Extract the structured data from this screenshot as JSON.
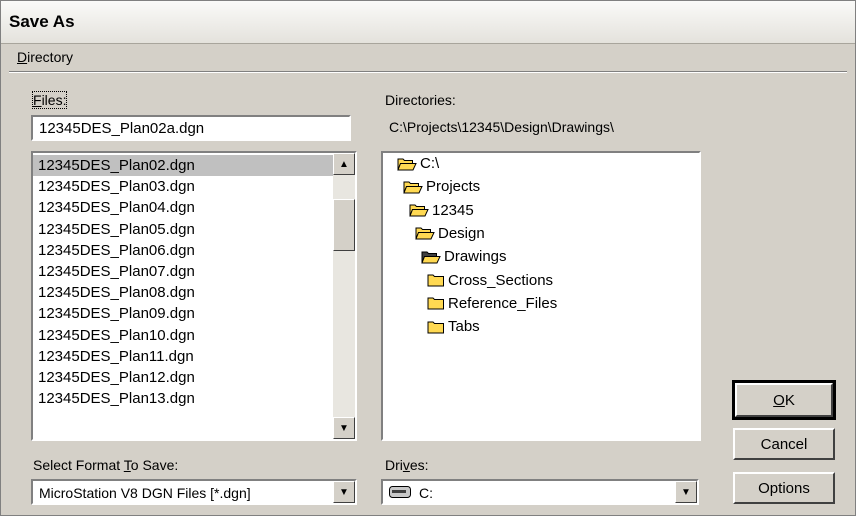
{
  "window": {
    "title": "Save As"
  },
  "menu": {
    "directory_mnemonic": "D",
    "directory_rest": "irectory"
  },
  "files": {
    "label_mnemonic": "F",
    "label_rest": "iles:",
    "filename_value": "12345DES_Plan02a.dgn",
    "items": [
      "12345DES_Plan02.dgn",
      "12345DES_Plan03.dgn",
      "12345DES_Plan04.dgn",
      "12345DES_Plan05.dgn",
      "12345DES_Plan06.dgn",
      "12345DES_Plan07.dgn",
      "12345DES_Plan08.dgn",
      "12345DES_Plan09.dgn",
      "12345DES_Plan10.dgn",
      "12345DES_Plan11.dgn",
      "12345DES_Plan12.dgn",
      "12345DES_Plan13.dgn"
    ],
    "selected": "12345DES_Plan02.dgn"
  },
  "directories": {
    "label": "Directories:",
    "current_path": "C:\\Projects\\12345\\Design\\Drawings\\",
    "items": [
      {
        "name": "C:\\",
        "icon": "open-folder-icon"
      },
      {
        "name": "Projects",
        "icon": "open-folder-icon"
      },
      {
        "name": "12345",
        "icon": "open-folder-icon"
      },
      {
        "name": "Design",
        "icon": "open-folder-icon"
      },
      {
        "name": "Drawings",
        "icon": "open-folder-selected-icon"
      },
      {
        "name": "Cross_Sections",
        "icon": "closed-folder-icon"
      },
      {
        "name": "Reference_Files",
        "icon": "closed-folder-icon"
      },
      {
        "name": "Tabs",
        "icon": "closed-folder-icon"
      }
    ]
  },
  "format": {
    "label_pre": "Select Format ",
    "label_mnemonic": "T",
    "label_post": "o Save:",
    "value": "MicroStation V8 DGN Files [*.dgn]"
  },
  "drives": {
    "label_pre": "Dri",
    "label_mnemonic": "v",
    "label_post": "es:",
    "value": "C:",
    "icon": "drive-icon"
  },
  "buttons": {
    "ok_mnemonic": "O",
    "ok_rest": "K",
    "cancel": "Cancel",
    "options": "Options"
  },
  "colors": {
    "dialog_face": "#d4d0c8",
    "folder_fill": "#ffd952",
    "selected_row": "#c0c0c0"
  }
}
